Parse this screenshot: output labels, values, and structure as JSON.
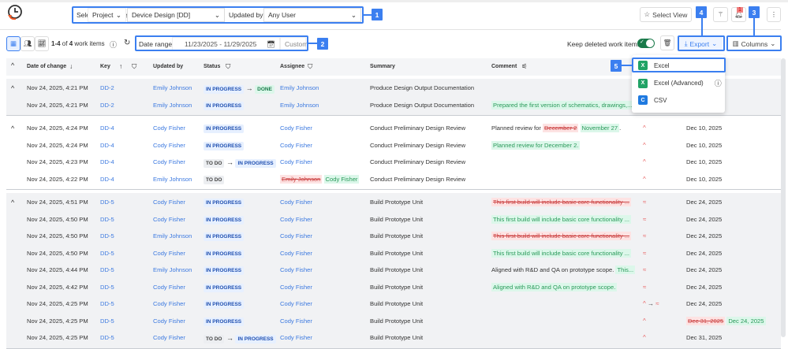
{
  "toolbar": {
    "select_label": "Select work items by:",
    "project_select": "Project",
    "project_value": "Device Design [DD]",
    "updated_by_label": "Updated by:",
    "updated_by_value": "Any User",
    "select_view": "Select View",
    "notification_count": "1"
  },
  "subbar": {
    "count_prefix": "1-4",
    "count_of": "of",
    "count_total": "4",
    "count_suffix": "work items",
    "date_range_label": "Date range:",
    "date_range_value": "11/23/2025 - 11/29/2025",
    "date_range_mode": "Custom",
    "keep_deleted_label": "Keep deleted work items",
    "keep_deleted_on": true,
    "export_label": "Export",
    "columns_label": "Columns"
  },
  "export_menu": {
    "items": [
      {
        "label": "Excel",
        "icon": "excel-icon",
        "color": "#21a366"
      },
      {
        "label": "Excel (Advanced)",
        "icon": "excel-icon",
        "color": "#21a366"
      },
      {
        "label": "CSV",
        "icon": "csv-icon",
        "color": "#1f7ae0"
      }
    ]
  },
  "annotations": [
    "1",
    "2",
    "3",
    "4",
    "5"
  ],
  "columns": [
    "Date of change",
    "Key",
    "Updated by",
    "Status",
    "Assignee",
    "Summary",
    "Comment"
  ],
  "groups": [
    {
      "bg": "#f1f2f4",
      "rows": [
        {
          "date": "Nov 24, 2025, 4:21 PM",
          "key": "DD-2",
          "updated_by": "Emily Johnson",
          "status": [
            "IN PROGRESS",
            "DONE"
          ],
          "assignee": "Emily Johnson",
          "summary": "Produce Design Output Documentation"
        },
        {
          "date": "Nov 24, 2025, 4:21 PM",
          "key": "DD-2",
          "updated_by": "Emily Johnson",
          "status": [
            "IN PROGRESS"
          ],
          "assignee": "Emily Johnson",
          "summary": "Produce Design Output Documentation",
          "comment_new": "Prepared the first version of schematics, drawings,..."
        }
      ]
    },
    {
      "bg": "#ffffff",
      "rows": [
        {
          "date": "Nov 24, 2025, 4:24 PM",
          "key": "DD-4",
          "updated_by": "Cody Fisher",
          "status": [
            "IN PROGRESS"
          ],
          "assignee": "Cody Fisher",
          "summary": "Conduct Preliminary Design Review",
          "comment_plain": "Planned review for",
          "comment_old": "December 2",
          "comment_new": "November 27",
          "comment_tail": ".",
          "priority": [
            "medium"
          ],
          "due": "Dec 10, 2025"
        },
        {
          "date": "Nov 24, 2025, 4:24 PM",
          "key": "DD-4",
          "updated_by": "Cody Fisher",
          "status": [
            "IN PROGRESS"
          ],
          "assignee": "Cody Fisher",
          "summary": "Conduct Preliminary Design Review",
          "comment_new": "Planned review for December 2.",
          "priority": [
            "medium"
          ],
          "due": "Dec 10, 2025"
        },
        {
          "date": "Nov 24, 2025, 4:23 PM",
          "key": "DD-4",
          "updated_by": "Cody Fisher",
          "status": [
            "TO DO",
            "IN PROGRESS"
          ],
          "assignee": "Cody Fisher",
          "summary": "Conduct Preliminary Design Review",
          "priority": [
            "medium"
          ],
          "due": "Dec 10, 2025"
        },
        {
          "date": "Nov 24, 2025, 4:22 PM",
          "key": "DD-4",
          "updated_by": "Emily Johnson",
          "status": [
            "TO DO"
          ],
          "assignee_old": "Emily Johnson",
          "assignee": "Cody Fisher",
          "summary": "Conduct Preliminary Design Review",
          "priority": [
            "medium"
          ],
          "due": "Dec 10, 2025"
        }
      ]
    },
    {
      "bg": "#f1f2f4",
      "rows": [
        {
          "date": "Nov 24, 2025, 4:51 PM",
          "key": "DD-5",
          "updated_by": "Cody Fisher",
          "status": [
            "IN PROGRESS"
          ],
          "assignee": "Cody Fisher",
          "summary": "Build Prototype Unit",
          "comment_old": "This first build will include basic core functionality ...",
          "priority": [
            "high"
          ],
          "due": "Dec 24, 2025"
        },
        {
          "date": "Nov 24, 2025, 4:50 PM",
          "key": "DD-5",
          "updated_by": "Cody Fisher",
          "status": [
            "IN PROGRESS"
          ],
          "assignee": "Cody Fisher",
          "summary": "Build Prototype Unit",
          "comment_new": "This first build will include basic core functionality ...",
          "priority": [
            "high"
          ],
          "due": "Dec 24, 2025"
        },
        {
          "date": "Nov 24, 2025, 4:50 PM",
          "key": "DD-5",
          "updated_by": "Emily Johnson",
          "status": [
            "IN PROGRESS"
          ],
          "assignee": "Cody Fisher",
          "summary": "Build Prototype Unit",
          "comment_old": "This first build will include basic core functionality ...",
          "priority": [
            "high"
          ],
          "due": "Dec 24, 2025"
        },
        {
          "date": "Nov 24, 2025, 4:50 PM",
          "key": "DD-5",
          "updated_by": "Cody Fisher",
          "status": [
            "IN PROGRESS"
          ],
          "assignee": "Cody Fisher",
          "summary": "Build Prototype Unit",
          "comment_new": "This first build will include basic core functionality ...",
          "priority": [
            "high"
          ],
          "due": "Dec 24, 2025"
        },
        {
          "date": "Nov 24, 2025, 4:44 PM",
          "key": "DD-5",
          "updated_by": "Emily Johnson",
          "status": [
            "IN PROGRESS"
          ],
          "assignee": "Cody Fisher",
          "summary": "Build Prototype Unit",
          "comment_plain": "Aligned with R&D and QA on prototype scope.",
          "comment_new": "This...",
          "priority": [
            "high"
          ],
          "due": "Dec 24, 2025"
        },
        {
          "date": "Nov 24, 2025, 4:42 PM",
          "key": "DD-5",
          "updated_by": "Cody Fisher",
          "status": [
            "IN PROGRESS"
          ],
          "assignee": "Cody Fisher",
          "summary": "Build Prototype Unit",
          "comment_new": "Aligned with R&D and QA on prototype scope.",
          "priority": [
            "high"
          ],
          "due": "Dec 24, 2025"
        },
        {
          "date": "Nov 24, 2025, 4:25 PM",
          "key": "DD-5",
          "updated_by": "Cody Fisher",
          "status": [
            "IN PROGRESS"
          ],
          "assignee": "Cody Fisher",
          "summary": "Build Prototype Unit",
          "priority": [
            "medium",
            "high"
          ],
          "due": "Dec 24, 2025"
        },
        {
          "date": "Nov 24, 2025, 4:25 PM",
          "key": "DD-5",
          "updated_by": "Cody Fisher",
          "status": [
            "IN PROGRESS"
          ],
          "assignee": "Cody Fisher",
          "summary": "Build Prototype Unit",
          "priority": [
            "medium"
          ],
          "due_old": "Dec 31, 2025",
          "due": "Dec 24, 2025"
        },
        {
          "date": "Nov 24, 2025, 4:25 PM",
          "key": "DD-5",
          "updated_by": "Cody Fisher",
          "status": [
            "TO DO",
            "IN PROGRESS"
          ],
          "assignee": "Cody Fisher",
          "summary": "Build Prototype Unit",
          "priority": [
            "medium"
          ],
          "due": "Dec 31, 2025"
        }
      ]
    }
  ]
}
